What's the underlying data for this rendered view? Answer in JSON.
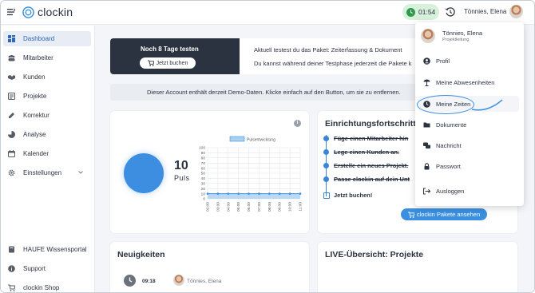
{
  "app": {
    "name": "clockin"
  },
  "topbar": {
    "timer": "01:54",
    "user_name": "Tönnies, Elena"
  },
  "sidebar": {
    "items": [
      {
        "label": "Dashboard",
        "icon": "dashboard-icon",
        "active": true
      },
      {
        "label": "Mitarbeiter",
        "icon": "people-icon"
      },
      {
        "label": "Kunden",
        "icon": "handshake-icon"
      },
      {
        "label": "Projekte",
        "icon": "projects-icon"
      },
      {
        "label": "Korrektur",
        "icon": "correction-icon"
      },
      {
        "label": "Analyse",
        "icon": "analysis-icon"
      },
      {
        "label": "Kalender",
        "icon": "calendar-icon"
      },
      {
        "label": "Einstellungen",
        "icon": "gear-icon"
      }
    ],
    "bottom_items": [
      {
        "label": "HAUFE Wissensportal",
        "icon": "book-icon"
      },
      {
        "label": "Support",
        "icon": "info-icon"
      },
      {
        "label": "clockin Shop",
        "icon": "cart-icon"
      }
    ]
  },
  "trial": {
    "title": "Noch 8 Tage testen",
    "buy_button": "Jetzt buchen",
    "line1": "Aktuell testest du das Paket:   Zeiterfassung & Dokument",
    "line2": "Du kannst während deiner Testphase jederzeit die Pakete k"
  },
  "demo_notice": "Dieser Account enthält derzeit Demo-Daten. Klicke einfach auf den Button, um sie zu entfernen.",
  "pulse": {
    "value": "10",
    "label": "Puls"
  },
  "chart_data": {
    "type": "area",
    "legend": [
      "Pulsentwicklung"
    ],
    "x": [
      "02:00",
      "03:00",
      "04:00",
      "05:00",
      "06:00",
      "07:00",
      "08:00",
      "09:00",
      "10:00",
      "11:00"
    ],
    "series": [
      {
        "name": "Pulsentwicklung",
        "values": [
          10,
          10,
          10,
          10,
          10,
          10,
          10,
          10,
          10,
          10
        ]
      }
    ],
    "yticks": [
      "0",
      "10",
      "20",
      "30",
      "40",
      "50",
      "60",
      "70",
      "80",
      "90",
      "100"
    ],
    "ylim": [
      0,
      100
    ],
    "grid": true
  },
  "setup": {
    "title": "Einrichtungsfortschritt",
    "steps": [
      {
        "label": "Füge einen Mitarbeiter hin",
        "done": true
      },
      {
        "label": "Lege einen Kunden an.",
        "done": true
      },
      {
        "label": "Erstelle ein neues Projekt.",
        "done": true
      },
      {
        "label": "Passe clockin auf dein Unt",
        "done": true
      },
      {
        "label": "Jetzt buchen!",
        "done": false
      }
    ],
    "button": "clockin Pakete ansehen"
  },
  "news": {
    "title": "Neuigkeiten",
    "time": "09:18",
    "author": "Tönnies, Elena"
  },
  "live": {
    "title": "LIVE-Übersicht: Projekte"
  },
  "dropdown": {
    "name": "Tönnies, Elena",
    "role": "Projektleitung",
    "items": [
      {
        "label": "Profil",
        "icon": "user-icon"
      },
      {
        "label": "Meine Abwesenheiten",
        "icon": "beach-umbrella-icon"
      },
      {
        "label": "Meine Zeiten",
        "icon": "clock-icon",
        "active": true
      },
      {
        "label": "Dokumente",
        "icon": "folder-icon"
      },
      {
        "label": "Nachricht",
        "icon": "chat-icon"
      },
      {
        "label": "Passwort",
        "icon": "lock-icon"
      },
      {
        "label": "Ausloggen",
        "icon": "logout-icon"
      }
    ]
  },
  "colors": {
    "accent": "#3a8fe0",
    "dark_banner": "#2b3340",
    "timer_bg": "#d7f1dc",
    "timer_dot": "#2f9a4b"
  }
}
